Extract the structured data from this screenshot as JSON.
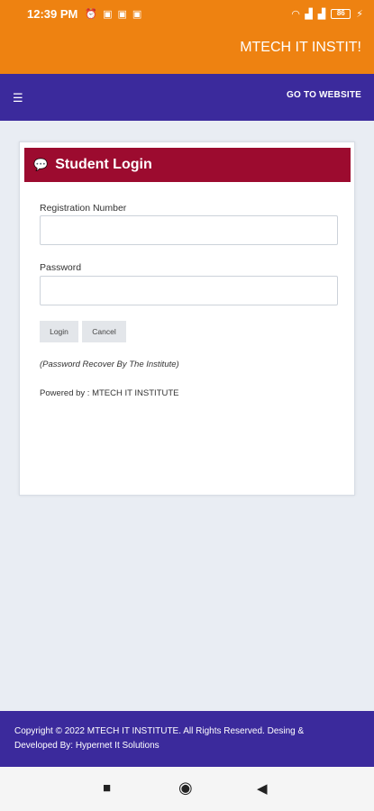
{
  "status": {
    "time": "12:39 PM",
    "left_icons": [
      "alarm-clock-icon",
      "notification-icon",
      "notification-icon",
      "notification-icon"
    ],
    "right_icons": [
      "wifi-icon",
      "signal-icon",
      "signal-icon"
    ],
    "battery": "86"
  },
  "appbar": {
    "title": "MTECH IT INSTIT!"
  },
  "navbar": {
    "menu_icon": "hamburger-icon",
    "go_to_website": "GO TO WEBSITE"
  },
  "login": {
    "title": "Student Login",
    "title_icon": "chat-icon",
    "reg_label": "Registration Number",
    "reg_value": "",
    "pass_label": "Password",
    "pass_value": "",
    "login_button": "Login",
    "cancel_button": "Cancel",
    "note": "(Password Recover By The Institute)",
    "powered_by": "Powered by : MTECH IT INSTITUTE"
  },
  "footer": {
    "line1": "Copyright © 2022 MTECH IT INSTITUTE. All Rights Reserved.      Desing &",
    "line2": "Developed By: Hypernet It Solutions"
  },
  "colors": {
    "orange": "#ee8211",
    "purple": "#3b2a9c",
    "crimson": "#9c0b2f"
  }
}
